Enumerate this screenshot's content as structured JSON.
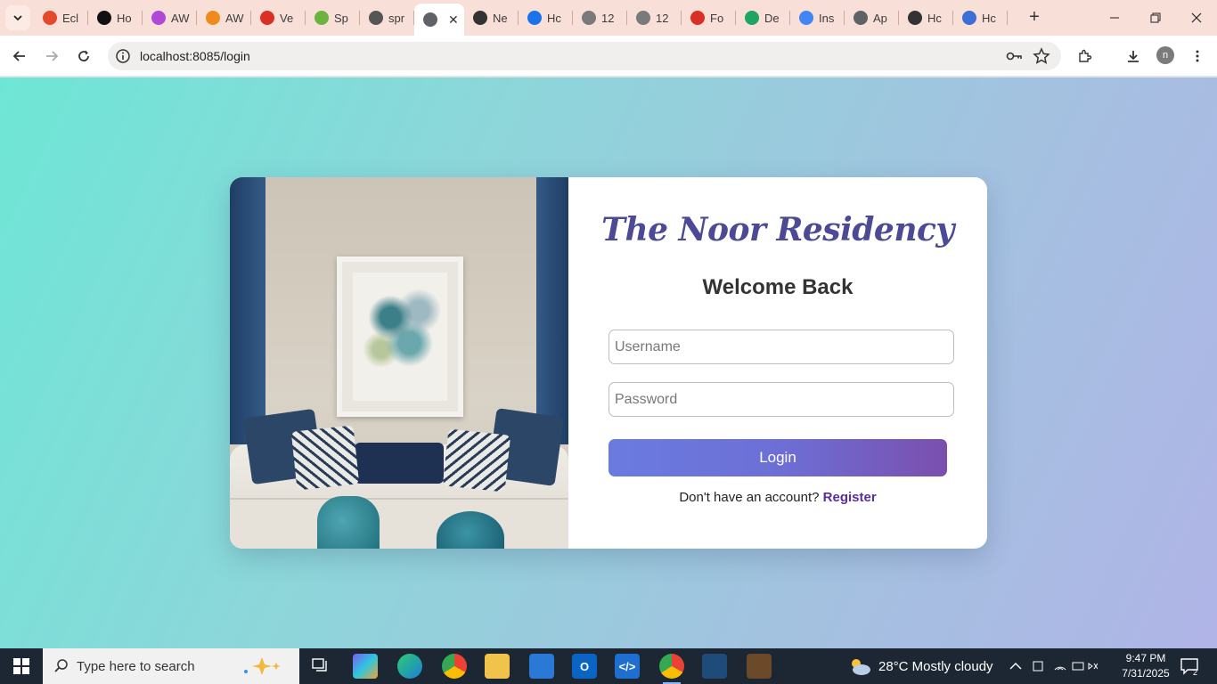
{
  "browser": {
    "tabs": [
      {
        "label": "Ecl",
        "color": "#e34a2b"
      },
      {
        "label": "Ho",
        "color": "#111111"
      },
      {
        "label": "AW",
        "color": "#b048d6"
      },
      {
        "label": "AW",
        "color": "#f08a1c"
      },
      {
        "label": "Ve",
        "color": "#d93025"
      },
      {
        "label": "Sp",
        "color": "#6db33f"
      },
      {
        "label": "spr",
        "color": "#555555"
      },
      {
        "label": "",
        "color": "#5f6368",
        "active": true
      },
      {
        "label": "Ne",
        "color": "#333333"
      },
      {
        "label": "Hc",
        "color": "#1a73e8"
      },
      {
        "label": "12",
        "color": "#7a7a7a"
      },
      {
        "label": "12",
        "color": "#7a7a7a"
      },
      {
        "label": "Fo",
        "color": "#d93025"
      },
      {
        "label": "De",
        "color": "#1fa463"
      },
      {
        "label": "Ins",
        "color": "#4285f4"
      },
      {
        "label": "Ap",
        "color": "#5f6368"
      },
      {
        "label": "Hc",
        "color": "#333333"
      },
      {
        "label": "Hc",
        "color": "#3b6fd6"
      }
    ],
    "active_tab_close": "✕",
    "new_tab": "+",
    "url": "localhost:8085/login",
    "profile_initial": "n"
  },
  "page": {
    "brand": "The Noor Residency",
    "heading": "Welcome Back",
    "username_placeholder": "Username",
    "password_placeholder": "Password",
    "login_label": "Login",
    "register_prompt": "Don't have an account?",
    "register_link": "Register",
    "colors": {
      "brand": "#4d4a95",
      "button_start": "#6a7be0",
      "button_end": "#7a4fae",
      "link": "#5a2ca0"
    }
  },
  "taskbar": {
    "search_placeholder": "Type here to search",
    "weather": "28°C  Mostly cloudy",
    "time": "9:47 PM",
    "date": "7/31/2025",
    "notification_count": "2"
  }
}
